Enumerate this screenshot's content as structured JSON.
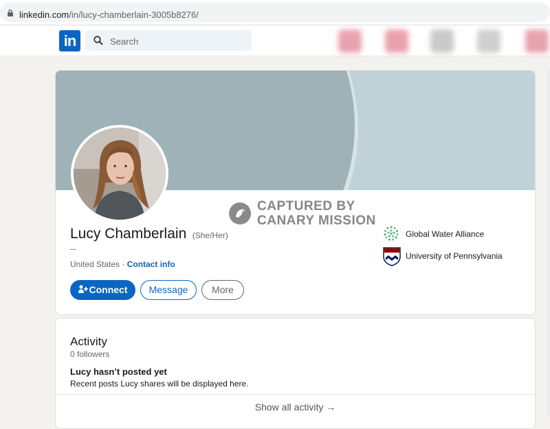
{
  "browser": {
    "url_host": "linkedin.com",
    "url_path": "/in/lucy-chamberlain-3005b8276/"
  },
  "nav": {
    "logo": "in",
    "search_placeholder": "Search"
  },
  "profile": {
    "name": "Lucy Chamberlain",
    "pronouns": "(She/Her)",
    "headline": "--",
    "location": "United States",
    "location_sep": " · ",
    "contact_info": "Contact info",
    "buttons": {
      "connect": "Connect",
      "message": "Message",
      "more": "More"
    },
    "orgs": [
      {
        "name": "Global Water Alliance",
        "icon": "global-water-alliance-logo"
      },
      {
        "name": "University of Pennsylvania",
        "icon": "upenn-shield-logo"
      }
    ]
  },
  "watermark": {
    "line1": "CAPTURED BY",
    "line2": "CANARY MISSION"
  },
  "activity": {
    "title": "Activity",
    "followers": "0 followers",
    "empty_title": "Lucy hasn’t posted yet",
    "empty_desc": "Recent posts Lucy shares will be displayed here.",
    "show_all": "Show all activity →"
  },
  "colors": {
    "brand": "#0a66c2",
    "banner": "#9eb2b8",
    "background": "#f3f2ef"
  }
}
